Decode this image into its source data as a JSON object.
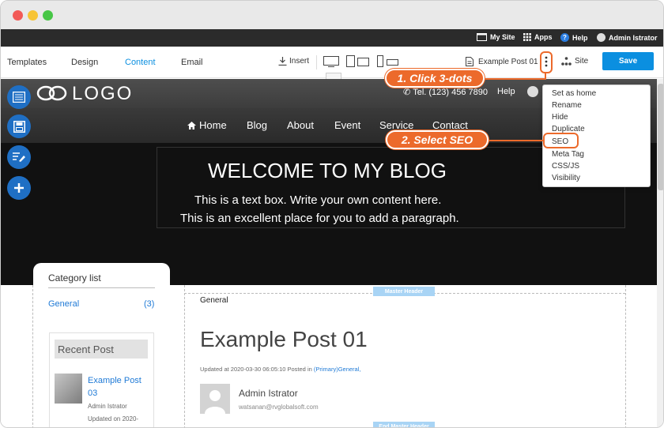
{
  "adminbar": {
    "my_site": "My Site",
    "apps": "Apps",
    "help": "Help",
    "user": "Admin Istrator"
  },
  "toolbar": {
    "tabs": [
      "Templates",
      "Design",
      "Content",
      "Email"
    ],
    "insert": "Insert",
    "page_name": "Example Post 01",
    "site": "Site",
    "save": "Save"
  },
  "site_header": {
    "logo": "LOGO",
    "phone": "Tel. (123) 456 7890",
    "help": "Help",
    "nav": [
      "Home",
      "Blog",
      "About",
      "Event",
      "Service",
      "Contact"
    ]
  },
  "hero": {
    "title": "WELCOME TO MY BLOG",
    "line1": "This is a text box. Write your own content here.",
    "line2": "This is an excellent place for you to add a paragraph."
  },
  "sidebar": {
    "category_title": "Category list",
    "category_item": "General",
    "category_count": "(3)",
    "recent_title": "Recent Post",
    "recent_item_title": "Example Post 03",
    "recent_item_author": "Admin Istrator",
    "recent_item_updated": "Updated on 2020-"
  },
  "post": {
    "breadcrumb": "General",
    "master_header": "Master Header",
    "end_master_header": "End Master Header",
    "title": "Example Post 01",
    "meta_prefix": "Updated at 2020-03-30 06:05:10 Posted in",
    "meta_link": "(Primary)General,",
    "author": "Admin Istrator",
    "email": "watsanan@rvglobalsoft.com"
  },
  "context_menu": {
    "items": [
      "Set as home",
      "Rename",
      "Hide",
      "Duplicate",
      "SEO",
      "Meta Tag",
      "CSS/JS",
      "Visibility"
    ]
  },
  "callouts": {
    "step1": "1. Click 3-dots",
    "step2": "2. Select SEO"
  },
  "colors": {
    "accent": "#0b8fe0",
    "callout": "#ec6a2b",
    "dark_header": "#3d3d3d"
  }
}
